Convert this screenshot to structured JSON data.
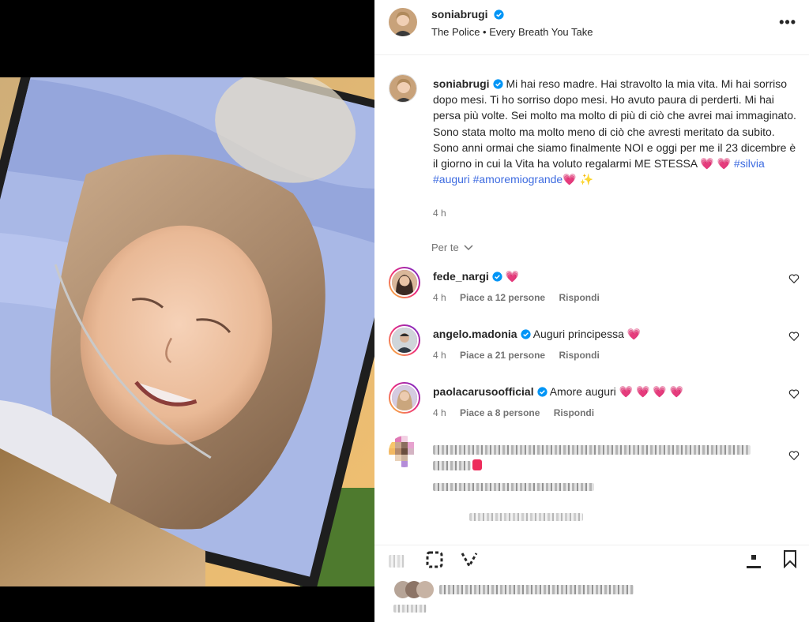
{
  "post": {
    "username": "soniabrugi",
    "audio": "The Police • Every Breath You Take",
    "more_label": "•••"
  },
  "caption": {
    "username": "soniabrugi",
    "text": "Mi hai reso madre. Hai stravolto la mia vita. Mi hai sorriso dopo mesi. Ti ho sorriso dopo mesi. Ho avuto paura di perderti. Mi hai persa più volte. Sei molto ma molto di più di ciò che avrei mai immaginato. Sono stata molto ma molto meno di ciò che avresti meritato da subito. Sono anni ormai che siamo finalmente NOI e oggi per me il 23 dicembre è il giorno in cui la Vita ha voluto regalarmi ME STESSA",
    "emoji_hearts": "💗 💗",
    "hashtags": [
      "#silvia",
      "#auguri",
      "#amoremiogrande"
    ],
    "tail_emoji": "💗 ✨",
    "time": "4 h"
  },
  "filter_label": "Per te",
  "comments": [
    {
      "username": "fede_nargi",
      "text": "💗",
      "time": "4 h",
      "likes": "Piace a 12 persone",
      "reply": "Rispondi"
    },
    {
      "username": "angelo.madonia",
      "text": "Auguri principessa 💗",
      "time": "4 h",
      "likes": "Piace a 21 persone",
      "reply": "Rispondi"
    },
    {
      "username": "paolacarusoofficial",
      "text": "Amore auguri 💗 💗 💗 💗",
      "time": "4 h",
      "likes": "Piace a 8 persone",
      "reply": "Rispondi"
    }
  ],
  "colors": {
    "verified": "#0095f6",
    "heart": "#ed2c5b",
    "hashtag": "#3d6be0",
    "muted": "#737373",
    "text": "#262626"
  },
  "icons": {
    "more": "more-icon",
    "verified": "verified-badge-icon",
    "like": "heart-outline-icon",
    "save": "bookmark-icon",
    "share": "share-icon",
    "chevron": "chevron-down-icon"
  }
}
